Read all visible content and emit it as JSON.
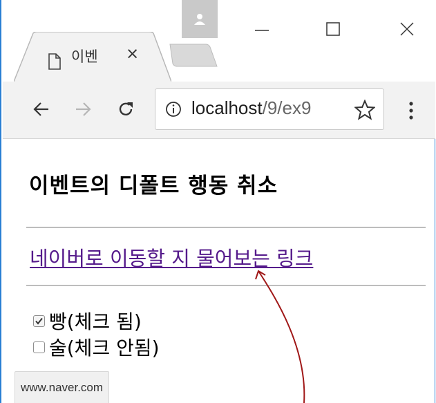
{
  "browser": {
    "tab": {
      "title": "이벤",
      "close_glyph": "×"
    },
    "window_controls": {
      "minimize": "—",
      "maximize": "☐",
      "close": "✕"
    },
    "toolbar": {
      "back_icon": "arrow-left-icon",
      "forward_icon": "arrow-right-icon",
      "reload_icon": "reload-icon",
      "url_host": "localhost",
      "url_path": "/9/ex9",
      "menu_icon": "more-vertical-icon"
    },
    "status_bar": "www.naver.com"
  },
  "page": {
    "heading": "이벤트의 디폴트 행동 취소",
    "link_text": "네이버로 이동할 지 물어보는 링크",
    "checkboxes": [
      {
        "label": "빵(체크 됨)",
        "checked": true
      },
      {
        "label": "술(체크 안됨)",
        "checked": false
      }
    ]
  },
  "colors": {
    "link": "#551a8b",
    "window_border": "#2a7fd4",
    "annotation_arrow": "#a01818"
  }
}
